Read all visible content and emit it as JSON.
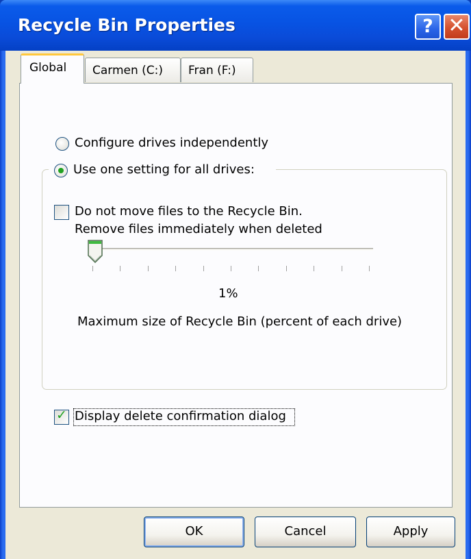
{
  "window": {
    "title": "Recycle Bin Properties",
    "help_glyph": "?",
    "close_glyph": "✕"
  },
  "tabs": [
    {
      "label": "Global",
      "selected": true
    },
    {
      "label": "Carmen (C:)",
      "selected": false
    },
    {
      "label": "Fran (F:)",
      "selected": false
    }
  ],
  "global": {
    "radio_independent": {
      "label": "Configure drives independently",
      "checked": false
    },
    "radio_one_setting": {
      "label": "Use one setting for all drives:",
      "checked": true
    },
    "no_move_checkbox": {
      "line1": "Do not move files to the Recycle Bin.",
      "line2": "Remove files immediately when deleted",
      "checked": false
    },
    "slider": {
      "value_percent": 1,
      "value_label": "1%",
      "tick_count": 11
    },
    "max_size_label": "Maximum size of Recycle Bin (percent of each drive)",
    "confirm_checkbox": {
      "label": "Display delete confirmation dialog",
      "checked": true
    }
  },
  "buttons": {
    "ok": "OK",
    "cancel": "Cancel",
    "apply": "Apply"
  },
  "colors": {
    "title_bar": "#0a5bea",
    "window_frame": "#2a6cf0",
    "dialog_face": "#ece9d8",
    "tab_panel": "#fcfcfe",
    "selected_tab_accent": "#ffc83c",
    "check_green": "#21a121",
    "close_red": "#d5512e"
  },
  "icons": {
    "help": "question-mark-icon",
    "close": "close-x-icon",
    "slider_thumb": "slider-thumb-icon",
    "check": "check-mark-icon"
  }
}
